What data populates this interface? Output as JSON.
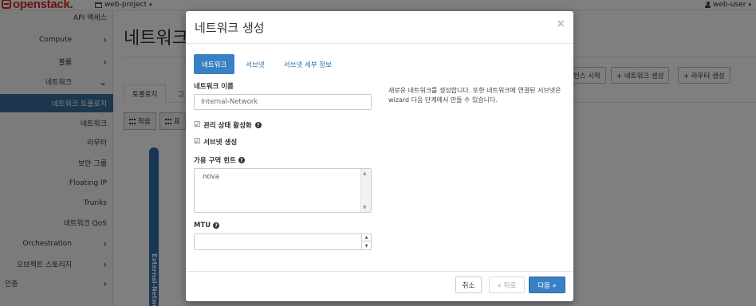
{
  "topbar": {
    "logo": "openstack.",
    "project": "web-project",
    "user": "web-user"
  },
  "sidebar": {
    "items": [
      {
        "label": "API 액세스"
      },
      {
        "label": "Compute"
      },
      {
        "label": "볼륨"
      },
      {
        "label": "네트워크"
      },
      {
        "label": "네트워크 토폴로지"
      },
      {
        "label": "네트워크"
      },
      {
        "label": "라우터"
      },
      {
        "label": "보안 그룹"
      },
      {
        "label": "Floating IP"
      },
      {
        "label": "Trunks"
      },
      {
        "label": "네트워크 QoS"
      },
      {
        "label": "Orchestration"
      },
      {
        "label": "오브젝트 스토리지"
      },
      {
        "label": "인증"
      }
    ]
  },
  "background": {
    "page_title": "네트워크",
    "actions": {
      "launch_instance": "턴스 시작",
      "create_network": "+ 네트워크 생성",
      "create_router": "+ 라우터 생성"
    },
    "tabs": {
      "topology": "토폴로지",
      "graph": "그"
    },
    "toggles": {
      "small": "작음",
      "normal": "표"
    },
    "network_label": "External-Network"
  },
  "modal": {
    "title": "네트워크 생성",
    "close": "×",
    "tabs": {
      "network": "네트워크",
      "subnet": "서브넷",
      "subnet_details": "서브넷 세부 정보"
    },
    "fields": {
      "network_name_label": "네트워크 이름",
      "network_name_value": "Internal-Network",
      "admin_state_label": "관리 상태 활성화",
      "create_subnet_label": "서브넷 생성",
      "az_hint_label": "가용 구역 힌트",
      "az_hint_option": "nova",
      "mtu_label": "MTU",
      "mtu_value": ""
    },
    "help_text": "새로운 네트워크를 생성합니다. 또한 네트워크에 연결된 서브넷은 wizard 다음 단계에서 만들 수 있습니다.",
    "footer": {
      "cancel": "취소",
      "back": "« 뒤로",
      "next": "다음 »"
    }
  }
}
